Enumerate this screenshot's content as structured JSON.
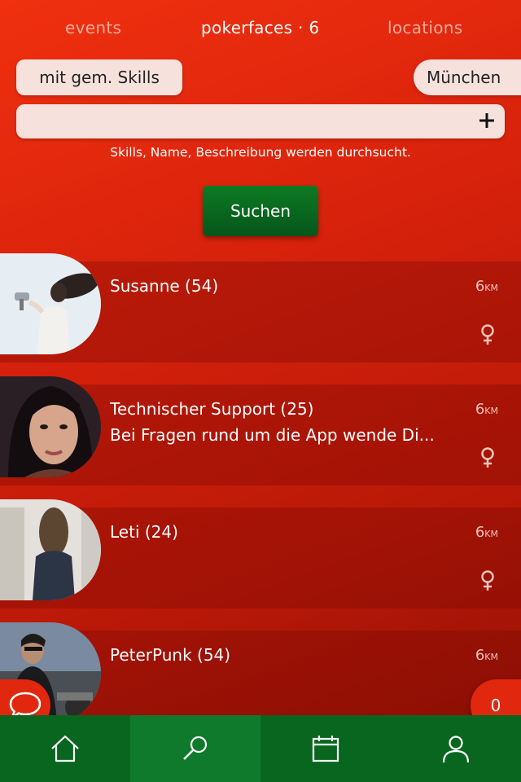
{
  "tabs": [
    {
      "label": "events"
    },
    {
      "label": "pokerfaces · 6"
    },
    {
      "label": "locations"
    }
  ],
  "filters": {
    "skills": "mit gem. Skills",
    "city": "München"
  },
  "search": {
    "value": "",
    "placeholder": "",
    "hint": "Skills, Name, Beschreibung werden durchsucht.",
    "button_label": "Suchen"
  },
  "results": [
    {
      "name": "Susanne (54)",
      "description": "",
      "distance": "6",
      "unit": "KM",
      "gender": "female-icon"
    },
    {
      "name": "Technischer Support (25)",
      "description": "Bei Fragen rund um die App wende Di...",
      "distance": "6",
      "unit": "KM",
      "gender": "female-icon"
    },
    {
      "name": "Leti (24)",
      "description": "",
      "distance": "6",
      "unit": "KM",
      "gender": "female-icon"
    },
    {
      "name": "PeterPunk (54)",
      "description": "",
      "distance": "6",
      "unit": "KM",
      "gender": ""
    }
  ],
  "chat": {
    "icon": "chat-bubble-icon"
  },
  "counter": {
    "value": "0"
  },
  "nav": [
    {
      "icon": "home-icon"
    },
    {
      "icon": "search-icon",
      "active": true
    },
    {
      "icon": "calendar-icon"
    },
    {
      "icon": "profile-icon"
    }
  ],
  "colors": {
    "background": "#d8220c",
    "accent_green": "#08661f",
    "pill": "#f7e1dd"
  }
}
